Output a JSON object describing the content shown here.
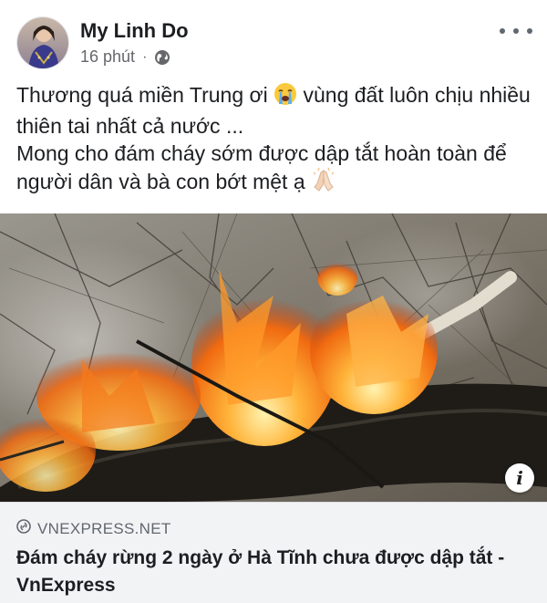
{
  "post": {
    "author": "My Linh Do",
    "time": "16 phút",
    "separator": "·",
    "privacy_icon": "globe-icon",
    "more_icon": "more-options-icon",
    "text_line1": "Thương quá miền Trung ơi",
    "emoji1": "😭",
    "text_line1_rest": " vùng đất luôn chịu nhiều thiên tai nhất cả nước ...",
    "text_line2": "Mong cho đám cháy sớm được dập tắt hoàn toàn để người dân và bà con bớt mệt ạ",
    "emoji2": "🙏🏻"
  },
  "link_preview": {
    "domain": "VNEXPRESS.NET",
    "title": "Đám cháy rừng 2 ngày ở Hà Tĩnh chưa được dập tắt - VnExpress",
    "info_label": "i"
  },
  "colors": {
    "text_primary": "#1c1e21",
    "text_secondary": "#65676b",
    "preview_bg": "#f2f3f5"
  }
}
